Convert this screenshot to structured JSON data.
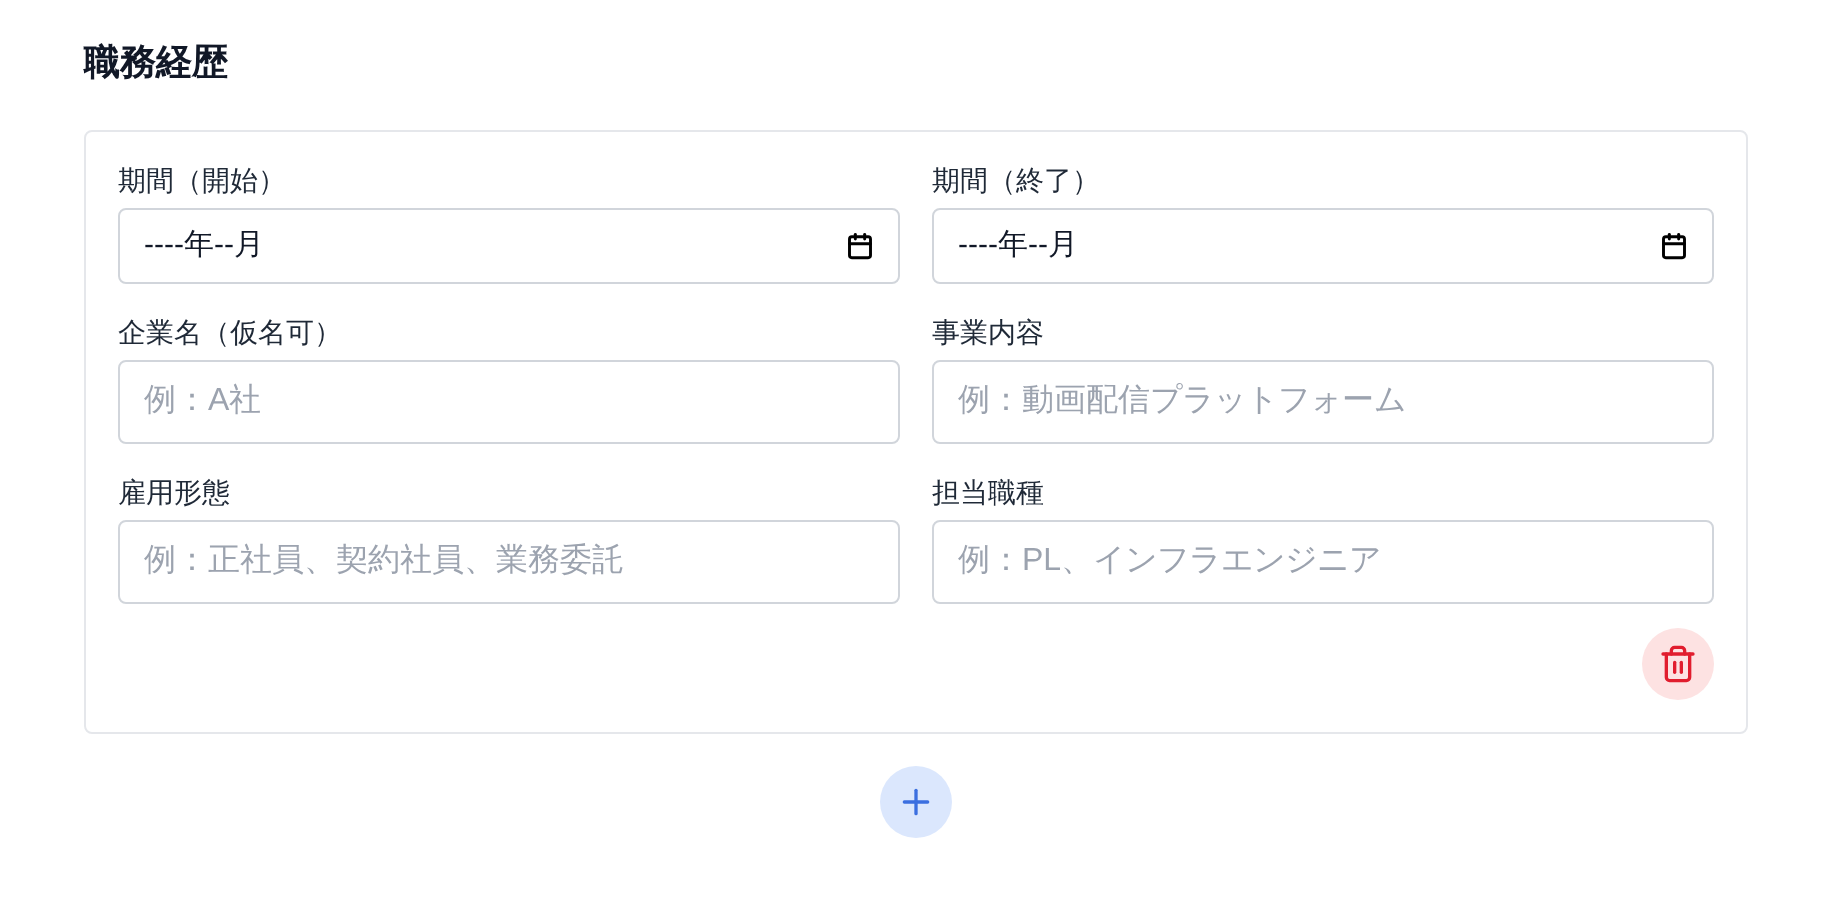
{
  "section": {
    "title": "職務経歴"
  },
  "entries": [
    {
      "fields": [
        {
          "kind": "date",
          "label": "期間（開始）",
          "display": "----年--月"
        },
        {
          "kind": "date",
          "label": "期間（終了）",
          "display": "----年--月"
        },
        {
          "kind": "text",
          "label": "企業名（仮名可）",
          "placeholder": "例：A社"
        },
        {
          "kind": "text",
          "label": "事業内容",
          "placeholder": "例：動画配信プラットフォーム"
        },
        {
          "kind": "text",
          "label": "雇用形態",
          "placeholder": "例：正社員、契約社員、業務委託"
        },
        {
          "kind": "text",
          "label": "担当職種",
          "placeholder": "例：PL、インフラエンジニア"
        }
      ]
    }
  ]
}
